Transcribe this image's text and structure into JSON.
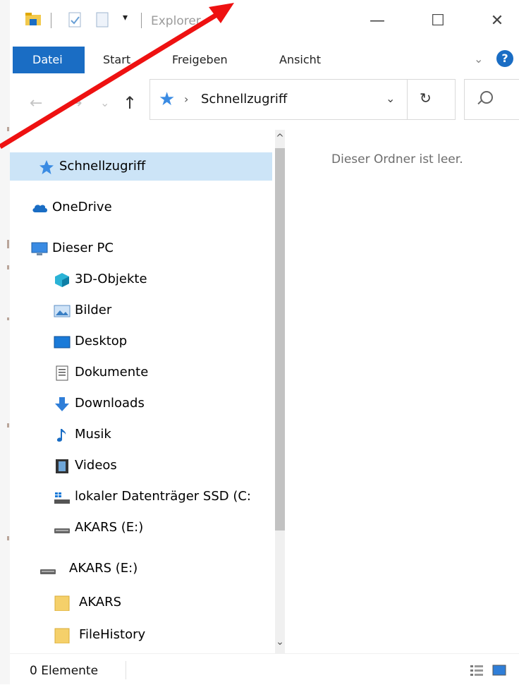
{
  "titlebar": {
    "title": "Explorer",
    "dropdown_glyph": "▾",
    "minimize_glyph": "—",
    "maximize_glyph": "☐",
    "close_glyph": "✕"
  },
  "ribbon": {
    "tabs": [
      "Datei",
      "Start",
      "Freigeben",
      "Ansicht"
    ],
    "collapse_glyph": "⌄",
    "help_label": "?"
  },
  "navbar": {
    "back_glyph": "←",
    "forward_glyph": "→",
    "recent_glyph": "⌄",
    "up_glyph": "↑",
    "address_separator": "›",
    "address_path": "Schnellzugriff",
    "address_dropdown": "⌄",
    "refresh_glyph": "↻"
  },
  "nav_pane": {
    "items": [
      {
        "label": "Schnellzugriff",
        "icon": "quick-access-star-icon",
        "selected": true
      },
      {
        "label": "OneDrive",
        "icon": "onedrive-cloud-icon"
      },
      {
        "label": "Dieser PC",
        "icon": "this-pc-monitor-icon"
      },
      {
        "label": "3D-Objekte",
        "icon": "3d-objects-icon"
      },
      {
        "label": "Bilder",
        "icon": "pictures-icon"
      },
      {
        "label": "Desktop",
        "icon": "desktop-icon"
      },
      {
        "label": "Dokumente",
        "icon": "documents-icon"
      },
      {
        "label": "Downloads",
        "icon": "downloads-arrow-icon"
      },
      {
        "label": "Musik",
        "icon": "music-note-icon"
      },
      {
        "label": "Videos",
        "icon": "videos-film-icon"
      },
      {
        "label": "lokaler Datenträger SSD (C:",
        "icon": "system-drive-icon"
      },
      {
        "label": "AKARS (E:)",
        "icon": "drive-icon"
      },
      {
        "label": "AKARS (E:)",
        "icon": "drive-icon"
      },
      {
        "label": "AKARS",
        "icon": "folder-icon"
      },
      {
        "label": "FileHistory",
        "icon": "folder-icon"
      }
    ],
    "scroll_up_glyph": "^",
    "scroll_down_glyph": "⌄"
  },
  "content": {
    "empty_message": "Dieser Ordner ist leer."
  },
  "statusbar": {
    "item_count": "0 Elemente"
  },
  "colors": {
    "ribbon_active_tab": "#1a6dc4",
    "selection": "#cce4f7",
    "annotation_arrow": "#ee1111"
  }
}
